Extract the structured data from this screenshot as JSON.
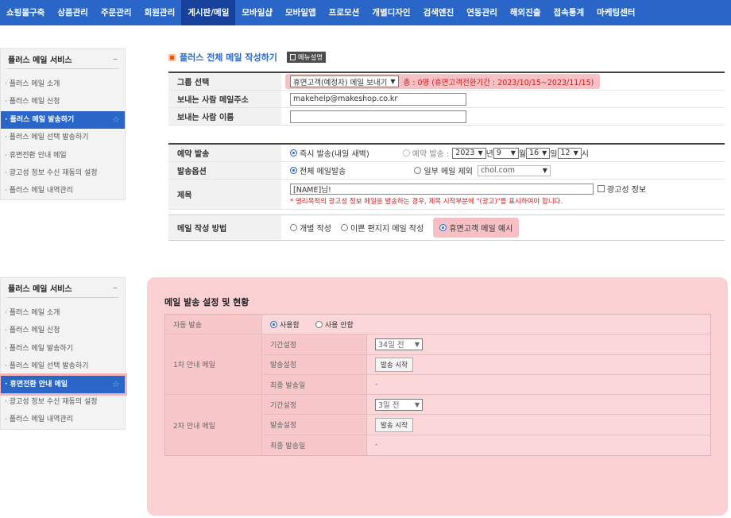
{
  "nav": {
    "items": [
      "쇼핑몰구축",
      "상품관리",
      "주문관리",
      "회원관리",
      "게시판/메일",
      "모바일샵",
      "모바일앱",
      "프로모션",
      "개별디자인",
      "검색엔진",
      "연동관리",
      "해외진출",
      "접속통계",
      "마케팅센터"
    ],
    "active_index": 4
  },
  "sidebar1": {
    "title": "플러스 메일 서비스",
    "collapse": "–",
    "items": [
      "· 플러스 메일 소개",
      "· 플러스 메일 신청",
      "· 플러스 메일 발송하기",
      "· 플러스 메일 선택 발송하기",
      "· 휴면전환 안내 메일",
      "· 광고성 정보 수신 재동의 설정",
      "· 플러스 메일 내역관리"
    ],
    "active_index": 2
  },
  "sidebar2": {
    "title": "플러스 메일 서비스",
    "collapse": "–",
    "items": [
      "· 플러스 메일 소개",
      "· 플러스 메일 신청",
      "· 플러스 메일 발송하기",
      "· 플러스 메일 선택 발송하기",
      "· 휴면전환 안내 메일",
      "· 광고성 정보 수신 재동의 설정",
      "· 플러스 메일 내역관리"
    ],
    "active_index": 4
  },
  "form": {
    "title": "플러스 전체 메일 작성하기",
    "manual": "메뉴설명",
    "group_label": "그룹 선택",
    "group_select": "휴면고객(예정자) 메일 보내기",
    "group_count": "총 : 0명 (휴면고객전환기간 : 2023/10/15~2023/11/15)",
    "sender_email_label": "보내는 사람 메일주소",
    "sender_email": "makehelp@makeshop.co.kr",
    "sender_name_label": "보내는 사람 이름",
    "sender_name": "",
    "reserve_label": "예약 발송",
    "reserve_now": "즉시 발송(내일 새벽)",
    "reserve_later": "예약 발송 :",
    "year": "2023",
    "year_unit": "년",
    "month": "9",
    "month_unit": "월",
    "day": "16",
    "day_unit": "일",
    "hour": "12",
    "hour_unit": "시",
    "option_label": "발송옵션",
    "option_all": "전체 메일발송",
    "option_partial": "일부 메일 제외",
    "option_domain": "chol.com",
    "subject_label": "제목",
    "subject_value": "[NAME]님!",
    "ad_check": "광고성 정보",
    "notice": "* 영리목적의 광고성 정보 메일을 발송하는 경우, 제목 시작부분에 \"(광고)\"를 표시하여야 합니다.",
    "method_label": "메일 작성 방법",
    "method_individual": "개별 작성",
    "method_pretty": "이쁜 편지지 메일 작성",
    "method_dormant": "휴면고객 메일 예시"
  },
  "panel": {
    "title": "메일 발송 설정 및 현황",
    "auto_label": "자동 발송",
    "auto_on": "사용함",
    "auto_off": "사용 안함",
    "first_label": "1차 안내 메일",
    "second_label": "2차 안내 메일",
    "period_label": "기간설정",
    "send_label": "발송설정",
    "last_label": "최종 발송일",
    "first_period": "34일 전",
    "second_period": "3일 전",
    "send_button": "발송 시작",
    "dash": "-"
  }
}
